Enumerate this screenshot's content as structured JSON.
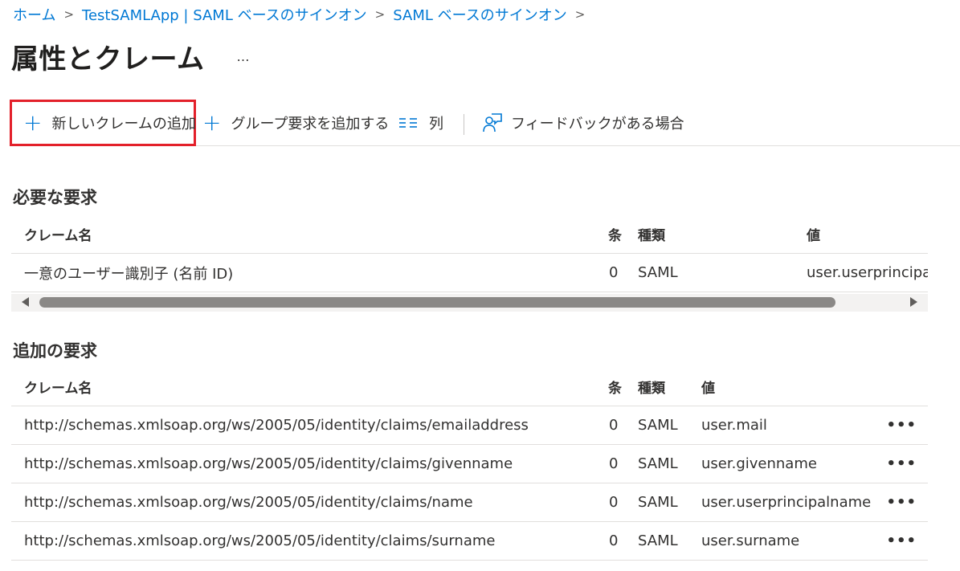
{
  "breadcrumb": {
    "items": [
      "ホーム",
      "TestSAMLApp | SAML ベースのサインオン",
      "SAML ベースのサインオン"
    ]
  },
  "page": {
    "title": "属性とクレーム",
    "more": "…"
  },
  "toolbar": {
    "add_claim": "新しいクレームの追加",
    "add_group_claim": "グループ要求を追加する",
    "columns": "列",
    "feedback": "フィードバックがある場合"
  },
  "required": {
    "title": "必要な要求",
    "headers": {
      "name": "クレーム名",
      "cond": "条",
      "type": "種類",
      "value": "値"
    },
    "rows": [
      {
        "name": "一意のユーザー識別子 (名前 ID)",
        "cond": "0",
        "type": "SAML",
        "value": "user.userprincipa"
      }
    ]
  },
  "additional": {
    "title": "追加の要求",
    "headers": {
      "name": "クレーム名",
      "cond": "条",
      "type": "種類",
      "value": "値"
    },
    "rows": [
      {
        "name": "http://schemas.xmlsoap.org/ws/2005/05/identity/claims/emailaddress",
        "cond": "0",
        "type": "SAML",
        "value": "user.mail",
        "more": "•••"
      },
      {
        "name": "http://schemas.xmlsoap.org/ws/2005/05/identity/claims/givenname",
        "cond": "0",
        "type": "SAML",
        "value": "user.givenname",
        "more": "•••"
      },
      {
        "name": "http://schemas.xmlsoap.org/ws/2005/05/identity/claims/name",
        "cond": "0",
        "type": "SAML",
        "value": "user.userprincipalname",
        "more": "•••"
      },
      {
        "name": "http://schemas.xmlsoap.org/ws/2005/05/identity/claims/surname",
        "cond": "0",
        "type": "SAML",
        "value": "user.surname",
        "more": "•••"
      }
    ]
  },
  "colors": {
    "accent": "#0078d4",
    "highlight": "#e3202a"
  },
  "icons": {
    "add": "plus-icon",
    "columns": "columns-icon",
    "feedback": "feedback-icon"
  }
}
